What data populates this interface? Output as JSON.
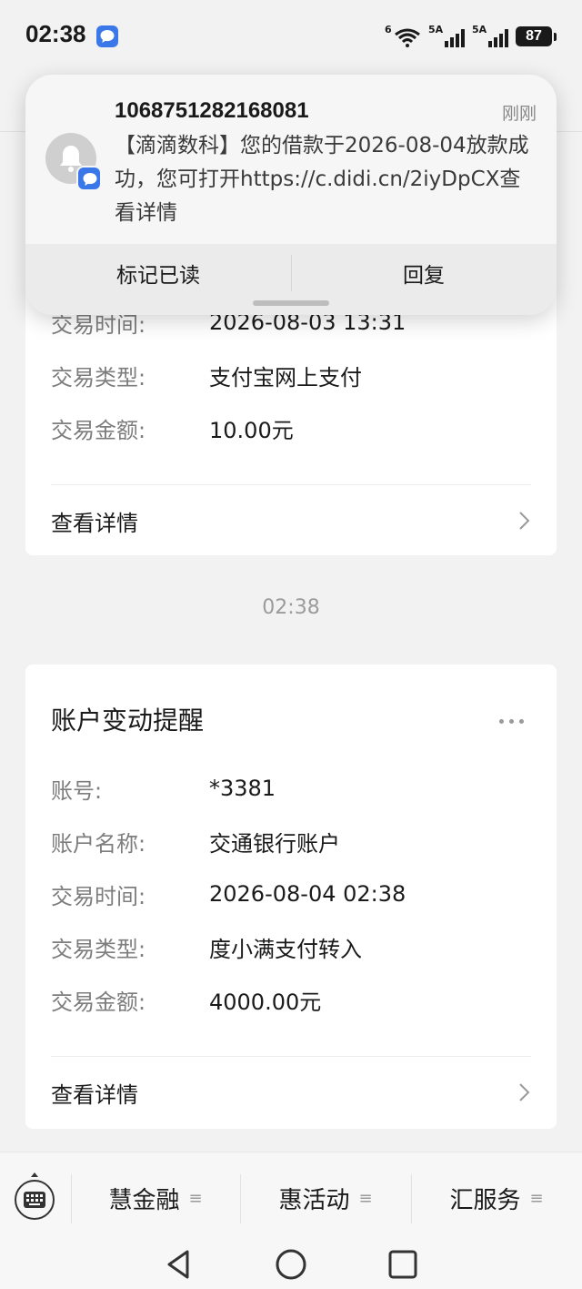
{
  "status_bar": {
    "time": "02:38",
    "wifi_label": "6",
    "signal1_label": "5A",
    "signal2_label": "5A",
    "battery": "87"
  },
  "card1": {
    "rows": [
      {
        "label": "交易时间:",
        "value": "2026-08-03 13:31"
      },
      {
        "label": "交易类型:",
        "value": "支付宝网上支付"
      },
      {
        "label": "交易金额:",
        "value": "10.00元"
      }
    ],
    "detail_label": "查看详情"
  },
  "time_separator": "02:38",
  "card2": {
    "title": "账户变动提醒",
    "rows": [
      {
        "label": "账号:",
        "value": "*3381"
      },
      {
        "label": "账户名称:",
        "value": "交通银行账户"
      },
      {
        "label": "交易时间:",
        "value": "2026-08-04 02:38"
      },
      {
        "label": "交易类型:",
        "value": "度小满支付转入"
      },
      {
        "label": "交易金额:",
        "value": "4000.00元"
      }
    ],
    "detail_label": "查看详情"
  },
  "menu": {
    "items": [
      {
        "label": "慧金融"
      },
      {
        "label": "惠活动"
      },
      {
        "label": "汇服务"
      }
    ]
  },
  "notification": {
    "sender": "1068751282168081",
    "time": "刚刚",
    "body": "【滴滴数科】您的借款于2026-08-04放款成功，您可打开https://c.didi.cn/2iyDpCX查看详情",
    "actions": {
      "mark_read": "标记已读",
      "reply": "回复"
    }
  },
  "colors": {
    "accent_blue": "#3a78ea",
    "background": "#f2f2f2",
    "label_gray": "#7d7d7d"
  },
  "icons": [
    "message-app-icon",
    "wifi-icon",
    "signal-icon",
    "battery-icon",
    "more-icon",
    "chevron-right-icon",
    "keyboard-icon",
    "menu-lines-icon",
    "notification-bell-icon",
    "back-icon",
    "home-icon",
    "recents-icon"
  ]
}
